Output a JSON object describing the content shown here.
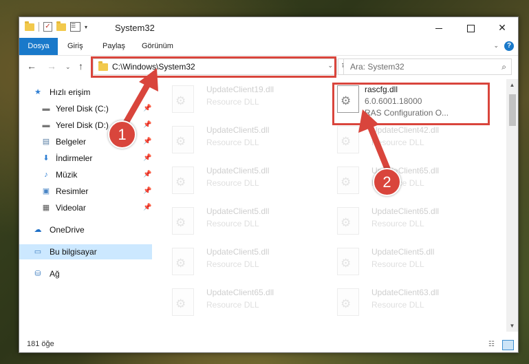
{
  "titlebar": {
    "title": "System32",
    "qat_dropdown": "▾"
  },
  "ribbon": {
    "tabs": [
      "Dosya",
      "Giriş",
      "Paylaş",
      "Görünüm"
    ],
    "expand": "⌄",
    "help": "?"
  },
  "nav": {
    "back": "←",
    "forward": "→",
    "recent": "⌄",
    "up": "↑",
    "address": "C:\\Windows\\System32",
    "address_dropdown": "⌄",
    "refresh": "↻",
    "search_placeholder": "Ara: System32"
  },
  "sidebar": {
    "items": [
      {
        "label": "Hızlı erişim",
        "icon": "★",
        "pinned": false
      },
      {
        "label": "Yerel Disk (C:)",
        "icon": "▬",
        "pinned": true
      },
      {
        "label": "Yerel Disk (D:)",
        "icon": "▬",
        "pinned": true
      },
      {
        "label": "Belgeler",
        "icon": "▤",
        "pinned": true
      },
      {
        "label": "İndirmeler",
        "icon": "⬇",
        "pinned": true
      },
      {
        "label": "Müzik",
        "icon": "♪",
        "pinned": true
      },
      {
        "label": "Resimler",
        "icon": "▣",
        "pinned": true
      },
      {
        "label": "Videolar",
        "icon": "▦",
        "pinned": true
      },
      {
        "label": "OneDrive",
        "icon": "☁",
        "pinned": false
      },
      {
        "label": "Bu bilgisayar",
        "icon": "▭",
        "pinned": false
      },
      {
        "label": "Ağ",
        "icon": "⛁",
        "pinned": false
      }
    ],
    "pin_glyph": "📌"
  },
  "files": {
    "left_column": [
      {
        "name": "UpdateClient19.dll",
        "desc": "Resource DLL"
      },
      {
        "name": "UpdateClient5.dll",
        "desc": "Resource DLL"
      },
      {
        "name": "UpdateClient5.dll",
        "desc": "Resource DLL"
      },
      {
        "name": "UpdateClient5.dll",
        "desc": "Resource DLL"
      },
      {
        "name": "UpdateClient5.dll",
        "desc": "Resource DLL"
      },
      {
        "name": "UpdateClient65.dll",
        "desc": "Resource DLL"
      }
    ],
    "right_column": [
      {
        "name": "rascfg.dll",
        "desc": "6.0.6001.18000",
        "desc2": "RAS Configuration O...",
        "highlight": true
      },
      {
        "name": "UpdateClient42.dll",
        "desc": "Resource DLL"
      },
      {
        "name": "UpdateClient65.dll",
        "desc": "Resource DLL"
      },
      {
        "name": "UpdateClient65.dll",
        "desc": "Resource DLL"
      },
      {
        "name": "UpdateClient5.dll",
        "desc": "Resource DLL"
      },
      {
        "name": "UpdateClient63.dll",
        "desc": "Resource DLL"
      }
    ]
  },
  "status": {
    "count": "181 öğe"
  },
  "annotations": {
    "step1": "1",
    "step2": "2",
    "accent": "#d9453c"
  }
}
